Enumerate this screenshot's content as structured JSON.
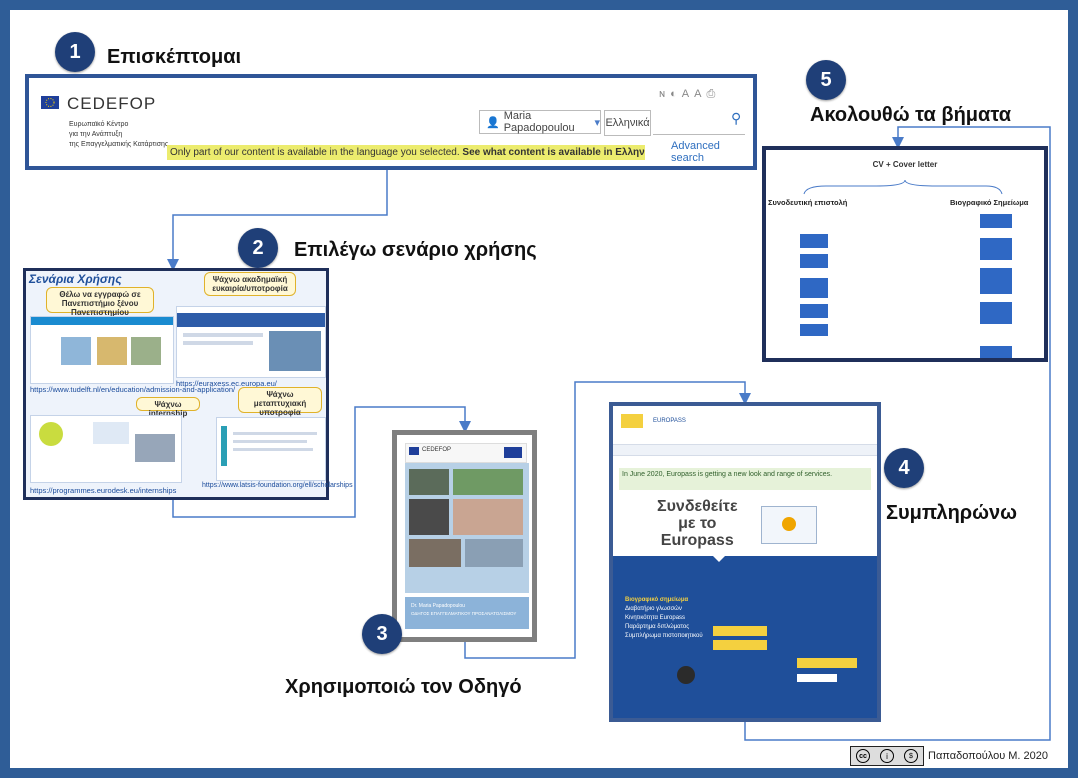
{
  "steps": [
    {
      "number": "1",
      "title": "Επισκέπτομαι"
    },
    {
      "number": "2",
      "title": "Επιλέγω σενάριο χρήσης"
    },
    {
      "number": "3",
      "title": "Χρησιμοποιώ τον Οδηγό"
    },
    {
      "number": "4",
      "title": "Συμπληρώνω"
    },
    {
      "number": "5",
      "title": "Ακολουθώ τα βήματα"
    }
  ],
  "cedefop": {
    "logo": "CEDEFOP",
    "subtitle_line1": "Ευρωπαϊκό Κέντρο",
    "subtitle_line2": "για την Ανάπτυξη",
    "subtitle_line3": "της Επαγγελματικής Κατάρτισης",
    "user": "Maria Papadopoulou",
    "language": "Ελληνικά",
    "search_placeholder": "",
    "advanced_search": "Advanced search",
    "notice_main": "Only part of our content is available in the language you selected.",
    "notice_link": "See what content is available in Ελληνικά.",
    "icons": [
      "rss-icon",
      "contrast-icon",
      "text-size-icon",
      "print-icon"
    ]
  },
  "scenarios": {
    "title": "Σενάρια Χρήσης",
    "bubble1": "Θέλω να εγγραφώ σε Πανεπιστήμιο ξένου Πανεπιστημίου",
    "bubble2": "Ψάχνω ακαδημαϊκή ευκαιρία/υποτροφία",
    "bubble3": "Ψάχνω internship",
    "bubble4": "Ψάχνω μεταπτυχιακή υποτροφία",
    "url1": "https://www.tudelft.nl/en/education/admission-and-application/",
    "url2": "https://euraxess.ec.europa.eu/",
    "url3": "https://www.latsis-foundation.org/ell/scholarships",
    "url4": "https://programmes.eurodesk.eu/internships"
  },
  "guide": {
    "logo": "CEDEFOP",
    "author": "Dr. Maria Papadopoulou",
    "caption": "ΟΔΗΓΟΣ ΕΠΑΓΓΕΛΜΑΤΙΚΟΥ ΠΡΟΣΑΝΑΤΟΛΙΣΜΟΥ"
  },
  "europass": {
    "banner": "In June 2020, Europass is getting a new look and range of services.",
    "hero_line1": "Συνδεθείτε",
    "hero_line2": "με το",
    "hero_line3": "Europass",
    "menu": [
      "Βιογραφικό σημείωμα",
      "Διαβατήριο γλωσσών",
      "Κινητικότητα Europass",
      "Παράρτημα διπλώματος",
      "Συμπλήρωμα πιστοποιητικού"
    ]
  },
  "cv": {
    "title": "CV + Cover letter",
    "left": "Συνοδευτική επιστολή",
    "right": "Βιογραφικό Σημείωμα"
  },
  "footer": {
    "license": "cc by nc",
    "author": "Παπαδοπούλου Μ. 2020"
  }
}
